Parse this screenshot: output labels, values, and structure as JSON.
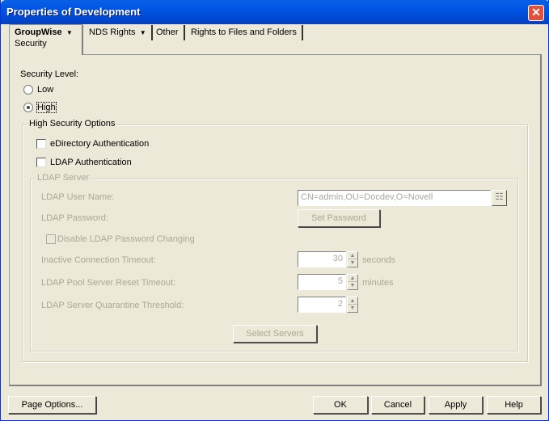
{
  "window": {
    "title": "Properties of Development",
    "close_icon": "close-icon"
  },
  "tabs": [
    {
      "label": "GroupWise",
      "sublabel": "Security",
      "active": true,
      "dropdown": true
    },
    {
      "label": "NDS Rights",
      "dropdown": true
    },
    {
      "label": "Other"
    },
    {
      "label": "Rights to Files and Folders"
    }
  ],
  "security_level": {
    "label": "Security Level:",
    "options": [
      "Low",
      "High"
    ],
    "selected": "High"
  },
  "high_security": {
    "group_label": "High Security Options",
    "edirectory_auth": {
      "label": "eDirectory Authentication",
      "checked": false
    },
    "ldap_auth": {
      "label": "LDAP Authentication",
      "checked": false
    },
    "ldap_server": {
      "group_label": "LDAP Server",
      "user_name_label": "LDAP User Name:",
      "user_name_value": "CN=admin,OU=Docdev,O=Novell",
      "password_label": "LDAP Password:",
      "set_password": "Set Password",
      "disable_pw_change": "Disable LDAP Password Changing",
      "inactive_timeout_label": "Inactive Connection Timeout:",
      "inactive_timeout_value": "30",
      "inactive_timeout_unit": "seconds",
      "pool_reset_label": "LDAP Pool Server Reset Timeout:",
      "pool_reset_value": "5",
      "pool_reset_unit": "minutes",
      "quarantine_label": "LDAP Server Quarantine Threshold:",
      "quarantine_value": "2",
      "select_servers": "Select Servers"
    }
  },
  "footer": {
    "page_options": "Page Options...",
    "ok": "OK",
    "cancel": "Cancel",
    "apply": "Apply",
    "help": "Help"
  }
}
